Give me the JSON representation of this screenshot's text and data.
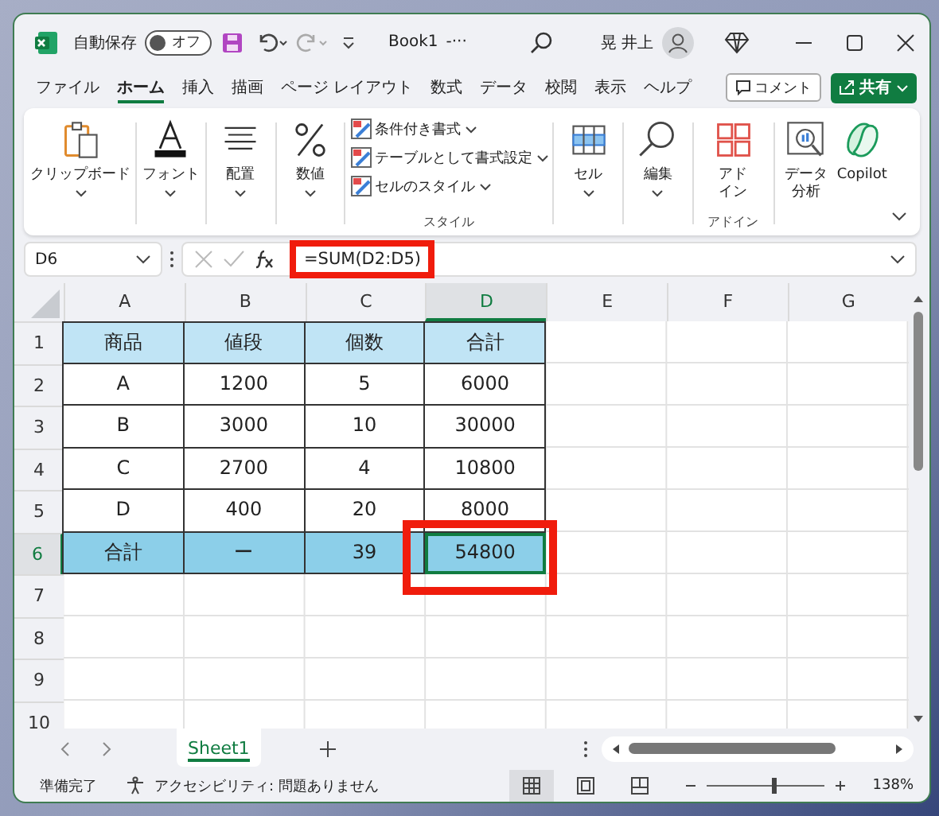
{
  "title_bar": {
    "autosave_label": "自動保存",
    "autosave": {
      "label": "オフ",
      "on": false
    },
    "file_name": "Book1",
    "file_suffix": "-···",
    "user_name": "晃 井上"
  },
  "menu_tabs": [
    {
      "label": "ファイル",
      "selected": false
    },
    {
      "label": "ホーム",
      "selected": true
    },
    {
      "label": "挿入",
      "selected": false
    },
    {
      "label": "描画",
      "selected": false
    },
    {
      "label": "ページ レイアウト",
      "selected": false
    },
    {
      "label": "数式",
      "selected": false
    },
    {
      "label": "データ",
      "selected": false
    },
    {
      "label": "校閲",
      "selected": false
    },
    {
      "label": "表示",
      "selected": false
    },
    {
      "label": "ヘルプ",
      "selected": false
    }
  ],
  "comment_button": "コメント",
  "share_button": "共有",
  "ribbon": {
    "clipboard": "クリップボード",
    "font": "フォント",
    "alignment": "配置",
    "number": "数値",
    "styles": [
      "条件付き書式",
      "テーブルとして書式設定",
      "セルのスタイル"
    ],
    "styles_group": "スタイル",
    "cells": "セル",
    "editing": "編集",
    "addins": "アドイン",
    "addins_group": "アドイン",
    "data_analysis": "データ分析",
    "copilot": "Copilot"
  },
  "formula_bar": {
    "name_box": "D6",
    "formula": "=SUM(D2:D5)",
    "highlighted": true
  },
  "columns": [
    {
      "label": "A",
      "selected": false
    },
    {
      "label": "B",
      "selected": false
    },
    {
      "label": "C",
      "selected": false
    },
    {
      "label": "D",
      "selected": true
    },
    {
      "label": "E",
      "selected": false
    },
    {
      "label": "F",
      "selected": false
    },
    {
      "label": "G",
      "selected": false
    }
  ],
  "rows": [
    {
      "number": "1",
      "selected": false,
      "kind": "header",
      "cells": [
        {
          "text": "商品",
          "selected": false
        },
        {
          "text": "値段",
          "selected": false
        },
        {
          "text": "個数",
          "selected": false
        },
        {
          "text": "合計",
          "selected": false
        }
      ]
    },
    {
      "number": "2",
      "selected": false,
      "kind": "body",
      "cells": [
        {
          "text": "A",
          "selected": false
        },
        {
          "text": "1200",
          "selected": false
        },
        {
          "text": "5",
          "selected": false
        },
        {
          "text": "6000",
          "selected": false
        }
      ]
    },
    {
      "number": "3",
      "selected": false,
      "kind": "body",
      "cells": [
        {
          "text": "B",
          "selected": false
        },
        {
          "text": "3000",
          "selected": false
        },
        {
          "text": "10",
          "selected": false
        },
        {
          "text": "30000",
          "selected": false
        }
      ]
    },
    {
      "number": "4",
      "selected": false,
      "kind": "body",
      "cells": [
        {
          "text": "C",
          "selected": false
        },
        {
          "text": "2700",
          "selected": false
        },
        {
          "text": "4",
          "selected": false
        },
        {
          "text": "10800",
          "selected": false
        }
      ]
    },
    {
      "number": "5",
      "selected": false,
      "kind": "body",
      "cells": [
        {
          "text": "D",
          "selected": false
        },
        {
          "text": "400",
          "selected": false
        },
        {
          "text": "20",
          "selected": false
        },
        {
          "text": "8000",
          "selected": false
        }
      ]
    },
    {
      "number": "6",
      "selected": true,
      "kind": "total",
      "cells": [
        {
          "text": "合計",
          "selected": false
        },
        {
          "text": "ー",
          "selected": false
        },
        {
          "text": "39",
          "selected": false
        },
        {
          "text": "54800",
          "selected": true,
          "highlighted": true
        }
      ]
    },
    {
      "number": "7",
      "selected": false,
      "kind": "empty"
    },
    {
      "number": "8",
      "selected": false,
      "kind": "empty"
    },
    {
      "number": "9",
      "selected": false,
      "kind": "empty"
    },
    {
      "number": "10",
      "selected": false,
      "kind": "empty"
    }
  ],
  "sheet_tabs": [
    {
      "label": "Sheet1",
      "selected": true
    }
  ],
  "status_bar": {
    "status": "準備完了",
    "accessibility": "アクセシビリティ: 問題ありません",
    "views": [
      {
        "kind": "normal",
        "selected": true
      },
      {
        "kind": "page_layout",
        "selected": false
      },
      {
        "kind": "page_break",
        "selected": false
      }
    ],
    "zoom": {
      "level": 0.57,
      "reading": "138%"
    }
  }
}
